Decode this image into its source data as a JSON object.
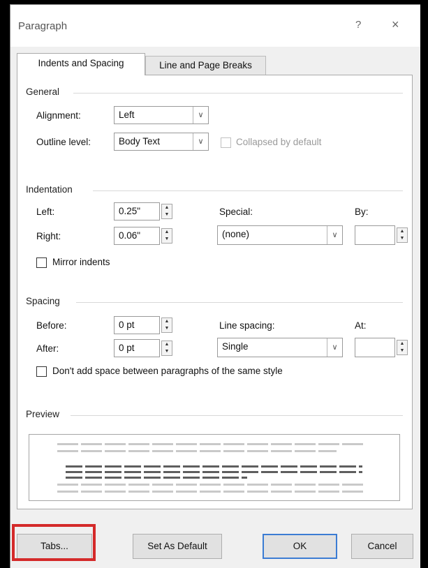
{
  "dialog": {
    "title": "Paragraph",
    "help": "?",
    "close": "×"
  },
  "tabs": [
    {
      "label": "Indents and Spacing",
      "active": true
    },
    {
      "label": "Line and Page Breaks",
      "active": false
    }
  ],
  "general": {
    "section": "General",
    "alignment_label": "Alignment:",
    "alignment_value": "Left",
    "outline_label": "Outline level:",
    "outline_value": "Body Text",
    "collapsed_label": "Collapsed by default"
  },
  "indentation": {
    "section": "Indentation",
    "left_label": "Left:",
    "left_value": "0.25\"",
    "right_label": "Right:",
    "right_value": "0.06\"",
    "special_label": "Special:",
    "special_value": "(none)",
    "by_label": "By:",
    "by_value": "",
    "mirror_label": "Mirror indents"
  },
  "spacing": {
    "section": "Spacing",
    "before_label": "Before:",
    "before_value": "0 pt",
    "after_label": "After:",
    "after_value": "0 pt",
    "line_spacing_label": "Line spacing:",
    "line_spacing_value": "Single",
    "at_label": "At:",
    "at_value": "",
    "dont_add_label": "Don't add space between paragraphs of the same style"
  },
  "preview": {
    "section": "Preview"
  },
  "buttons": {
    "tabs": "Tabs...",
    "set_default": "Set As Default",
    "ok": "OK",
    "cancel": "Cancel"
  },
  "colors": {
    "highlight": "#d42a2a",
    "ok_border": "#3b7cd3"
  }
}
